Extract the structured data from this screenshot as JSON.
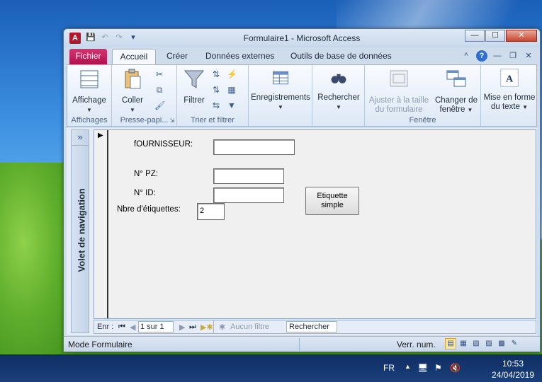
{
  "window": {
    "title": "Formulaire1  -  Microsoft Access",
    "app_icon_letter": "A",
    "controls": {
      "minimize": "—",
      "maximize": "☐",
      "close": "✕"
    }
  },
  "tabs": {
    "file": "Fichier",
    "items": [
      "Accueil",
      "Créer",
      "Données externes",
      "Outils de base de données"
    ],
    "active": "Accueil"
  },
  "ribbon": {
    "groups": {
      "affichages": {
        "label": "Affichages",
        "button": "Affichage"
      },
      "presse": {
        "label": "Presse-papi...",
        "button": "Coller"
      },
      "trier": {
        "label": "Trier et filtrer",
        "button": "Filtrer"
      },
      "enregistrements": {
        "button": "Enregistrements"
      },
      "rechercher": {
        "button": "Rechercher"
      },
      "fenetre": {
        "label": "Fenêtre",
        "button1_l1": "Ajuster à la taille",
        "button1_l2": "du formulaire",
        "button2_l1": "Changer de",
        "button2_l2": "fenêtre"
      },
      "texte": {
        "button_l1": "Mise en forme",
        "button_l2": "du texte"
      }
    }
  },
  "nav_pane": {
    "toggle": "»",
    "label": "Volet de navigation"
  },
  "form": {
    "fournisseur_label": "fOURNISSEUR:",
    "fournisseur_value": "",
    "pz_label": "N° PZ:",
    "pz_value": "",
    "id_label": "N° ID:",
    "id_value": "",
    "nbre_label": "Nbre d'étiquettes:",
    "nbre_value": "2",
    "button_line1": "Etiquette",
    "button_line2": "simple"
  },
  "record_nav": {
    "label": "Enr :",
    "record": "1 sur 1",
    "filter": "Aucun filtre",
    "search": "Rechercher"
  },
  "status": {
    "mode": "Mode Formulaire",
    "numlock": "Verr. num."
  },
  "taskbar": {
    "lang": "FR",
    "time": "10:53",
    "date": "24/04/2019"
  }
}
